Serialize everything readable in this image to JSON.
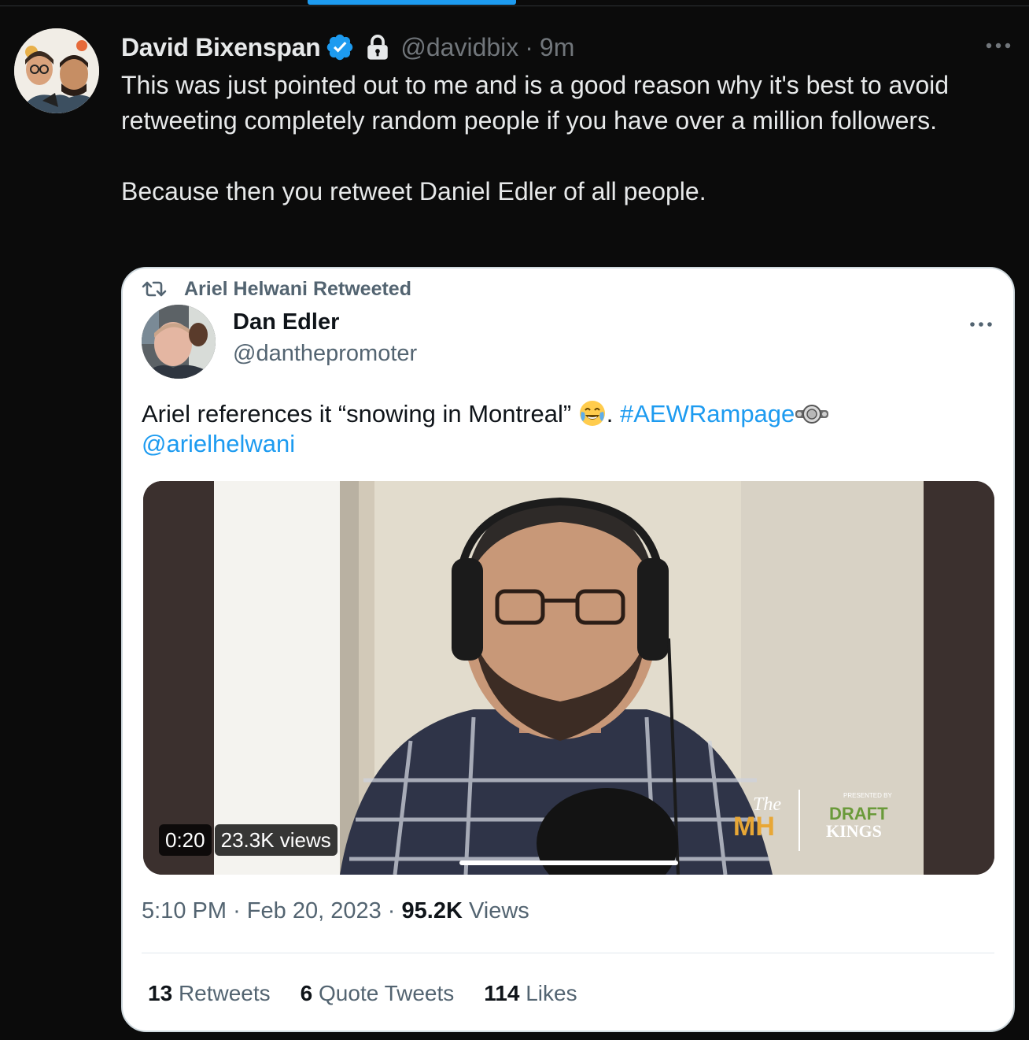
{
  "tweet": {
    "display_name": "David Bixenspan",
    "handle": "@davidbix",
    "separator": "·",
    "time": "9m",
    "text_para1": "This was just pointed out to me and is a good reason why it's best to avoid retweeting completely random people if you have over a million followers.",
    "text_para2": "Because then you retweet Daniel Edler of all people."
  },
  "quote": {
    "retweet_label": "Ariel Helwani Retweeted",
    "display_name": "Dan Edler",
    "handle": "@danthepromoter",
    "text_plain": "Ariel references it “snowing in Montreal” ",
    "text_after_emoji": ". ",
    "hashtag": "#AEWRampage",
    "mention": "@arielhelwani",
    "video": {
      "duration": "0:20",
      "views": "23.3K views",
      "overlay_logo_left_small": "The",
      "overlay_logo_left_big": "MH",
      "overlay_logo_right_small": "PRESENTED BY",
      "overlay_logo_right_mid": "DRAFT",
      "overlay_logo_right_big": "KINGS"
    },
    "time": "5:10 PM",
    "sep": "·",
    "date": "Feb 20, 2023",
    "views_count": "95.2K",
    "views_label": "Views",
    "stats": [
      {
        "count": "13",
        "label": "Retweets"
      },
      {
        "count": "6",
        "label": "Quote Tweets"
      },
      {
        "count": "114",
        "label": "Likes"
      }
    ]
  },
  "colors": {
    "background": "#0b0b0b",
    "accent": "#1d9bf0",
    "text_primary": "#e7e9ea",
    "text_secondary": "#71767b"
  },
  "icons": [
    "verified-badge-icon",
    "lock-icon",
    "more-icon",
    "retweet-icon",
    "joy-emoji-icon",
    "championship-belt-icon"
  ]
}
